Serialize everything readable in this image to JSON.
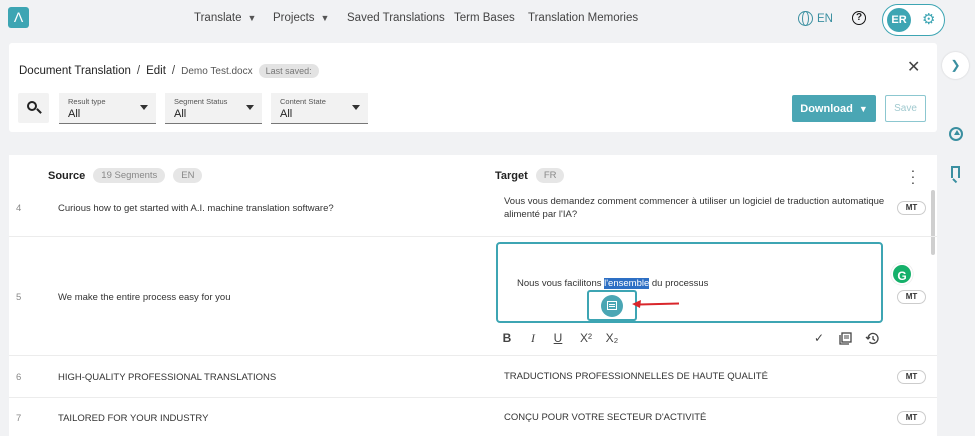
{
  "app": {
    "logo_glyph": "Λ",
    "brand_color": "#3da5b3"
  },
  "nav": {
    "translate": "Translate",
    "projects": "Projects",
    "saved_translations": "Saved Translations",
    "term_bases": "Term Bases",
    "translation_memories": "Translation Memories",
    "language": "EN",
    "user_initials": "ER"
  },
  "header": {
    "breadcrumb_root": "Document Translation",
    "breadcrumb_edit": "Edit",
    "file_name": "Demo Test.docx",
    "saved_status": "Last saved:",
    "download_label": "Download",
    "save_label": "Save"
  },
  "filters": [
    {
      "label": "Result type",
      "value": "All"
    },
    {
      "label": "Segment Status",
      "value": "All"
    },
    {
      "label": "Content State",
      "value": "All"
    }
  ],
  "columns": {
    "source_title": "Source",
    "segments_count": "19 Segments",
    "source_lang": "EN",
    "target_title": "Target",
    "target_lang": "FR"
  },
  "rows": [
    {
      "num": "4",
      "source": "Curious how to get started with A.I. machine translation software?",
      "target": "Vous vous demandez comment commencer à utiliser un logiciel de traduction automatique alimenté par l'IA?",
      "badge": "MT"
    },
    {
      "num": "5",
      "source": "We make the entire process easy for you",
      "target_before": "Nous vous facilitons ",
      "target_highlight": "l'ensemble",
      "target_after": " du processus",
      "badge": "MT"
    },
    {
      "num": "6",
      "source": "HIGH-QUALITY PROFESSIONAL TRANSLATIONS",
      "target": "TRADUCTIONS PROFESSIONNELLES DE HAUTE QUALITÉ",
      "badge": "MT"
    },
    {
      "num": "7",
      "source": "TAILORED FOR YOUR INDUSTRY",
      "target": "CONÇU POUR VOTRE SECTEUR D'ACTIVITÉ",
      "badge": "MT"
    }
  ],
  "editor": {
    "toolbar": {
      "bold": "B",
      "italic": "I",
      "underline": "U",
      "superscript": "X²",
      "subscript": "X₂",
      "confirm": "✓"
    },
    "grammarly_glyph": "G"
  },
  "icons": {
    "highlight_arrow_color": "#d9262b"
  }
}
